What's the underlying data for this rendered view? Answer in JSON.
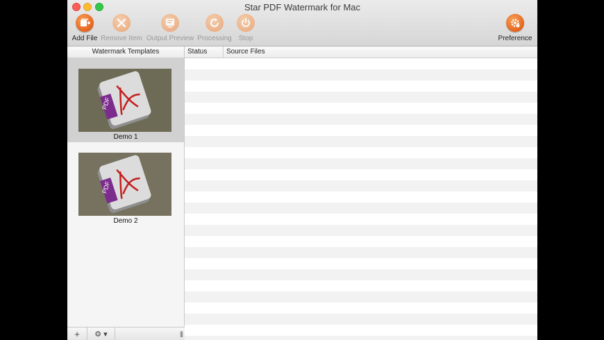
{
  "window": {
    "title": "Star PDF Watermark for Mac"
  },
  "toolbar": {
    "add_file": "Add File",
    "remove_item": "Remove Item",
    "output_preview": "Output Preview",
    "processing": "Processing",
    "stop": "Stop",
    "preference": "Preference"
  },
  "sidebar": {
    "header": "Watermark Templates",
    "templates": [
      {
        "label": "Demo 1",
        "selected": true,
        "thumb_text": "PDF"
      },
      {
        "label": "Demo 2",
        "selected": false,
        "thumb_text": "PDF"
      }
    ],
    "add_symbol": "+",
    "gear_symbol": "⚙ ▾",
    "resize_symbol": "|||"
  },
  "table": {
    "columns": [
      "Status",
      "Source Files"
    ]
  },
  "colors": {
    "accent": "#e5641e",
    "selection": "#d1d1d1"
  }
}
